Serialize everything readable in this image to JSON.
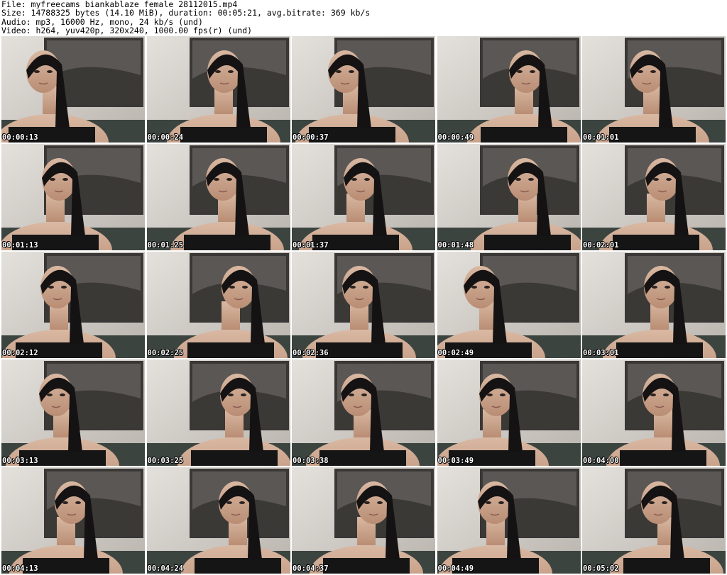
{
  "header": {
    "lines": [
      "File: myfreecams_biankablaze_female_28112015.mp4",
      "Size: 14788325 bytes (14.10 MiB), duration: 00:05:21, avg.bitrate: 369 kb/s",
      "Audio: mp3, 16000 Hz, mono, 24 kb/s (und)",
      "Video: h264, yuv420p, 320x240, 1000.00 fps(r) (und)"
    ]
  },
  "thumbnails": [
    {
      "timestamp": "00:00:13"
    },
    {
      "timestamp": "00:00:24"
    },
    {
      "timestamp": "00:00:37"
    },
    {
      "timestamp": "00:00:49"
    },
    {
      "timestamp": "00:01:01"
    },
    {
      "timestamp": "00:01:13"
    },
    {
      "timestamp": "00:01:25"
    },
    {
      "timestamp": "00:01:37"
    },
    {
      "timestamp": "00:01:48"
    },
    {
      "timestamp": "00:02:01"
    },
    {
      "timestamp": "00:02:12"
    },
    {
      "timestamp": "00:02:25"
    },
    {
      "timestamp": "00:02:36"
    },
    {
      "timestamp": "00:02:49"
    },
    {
      "timestamp": "00:03:01"
    },
    {
      "timestamp": "00:03:13"
    },
    {
      "timestamp": "00:03:25"
    },
    {
      "timestamp": "00:03:38"
    },
    {
      "timestamp": "00:03:49"
    },
    {
      "timestamp": "00:04:00"
    },
    {
      "timestamp": "00:04:13"
    },
    {
      "timestamp": "00:04:24"
    },
    {
      "timestamp": "00:04:37"
    },
    {
      "timestamp": "00:04:49"
    },
    {
      "timestamp": "00:05:02"
    }
  ],
  "colors": {
    "background": "#ffffff",
    "text": "#000000",
    "timestamp_text": "#ffffff",
    "timestamp_outline": "#000000"
  }
}
